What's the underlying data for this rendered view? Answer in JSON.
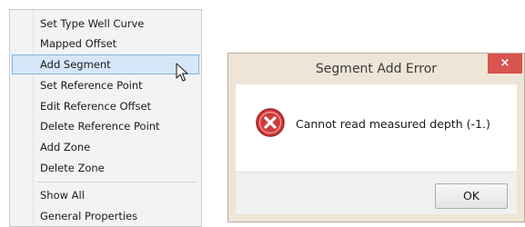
{
  "context_menu": {
    "items": [
      {
        "label": "Set Type Well Curve"
      },
      {
        "label": "Mapped Offset"
      },
      {
        "label": "Add Segment",
        "highlighted": true
      },
      {
        "label": "Set Reference Point"
      },
      {
        "label": "Edit Reference Offset"
      },
      {
        "label": "Delete Reference Point"
      },
      {
        "label": "Add Zone"
      },
      {
        "label": "Delete Zone"
      },
      {
        "label": "Show All"
      },
      {
        "label": "General Properties"
      }
    ],
    "highlight_color": "#d5e7f8"
  },
  "dialog": {
    "title": "Segment Add Error",
    "close_label": "×",
    "message": "Cannot read measured depth  (-1.)",
    "ok_label": "OK",
    "icon": "error-icon",
    "close_color": "#d9534f"
  }
}
